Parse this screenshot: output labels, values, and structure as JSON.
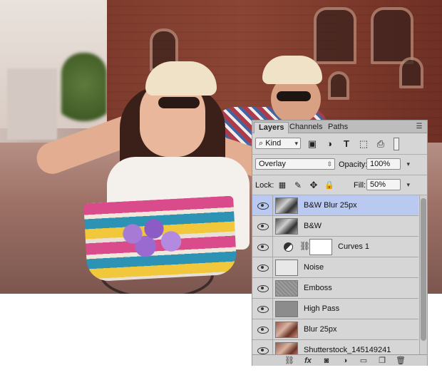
{
  "panel": {
    "tabs": [
      {
        "label": "Layers",
        "active": true
      },
      {
        "label": "Channels",
        "active": false
      },
      {
        "label": "Paths",
        "active": false
      }
    ],
    "filter": {
      "kind_label": "Kind",
      "icons": [
        "search-icon",
        "image-filter-icon",
        "adjustment-filter-icon",
        "type-filter-icon",
        "shape-filter-icon",
        "smart-object-filter-icon",
        "filter-toggle-icon"
      ]
    },
    "blend": {
      "mode": "Overlay",
      "opacity_label": "Opacity:",
      "opacity_value": "100%"
    },
    "lock": {
      "label": "Lock:",
      "icons": [
        "lock-transparent-icon",
        "lock-image-icon",
        "lock-position-icon",
        "lock-all-icon"
      ],
      "fill_label": "Fill:",
      "fill_value": "50%"
    },
    "layers": [
      {
        "name": "B&W Blur 25px",
        "thumb": "bw",
        "selected": true,
        "visible": true
      },
      {
        "name": "B&W",
        "thumb": "bw",
        "selected": false,
        "visible": true
      },
      {
        "name": "Curves 1",
        "thumb": "white",
        "adjustment": true,
        "selected": false,
        "visible": true
      },
      {
        "name": "Noise",
        "thumb": "noise",
        "selected": false,
        "visible": true
      },
      {
        "name": "Emboss",
        "thumb": "emboss",
        "selected": false,
        "visible": true
      },
      {
        "name": "High Pass",
        "thumb": "highpass",
        "selected": false,
        "visible": true
      },
      {
        "name": "Blur 25px",
        "thumb": "photo",
        "selected": false,
        "visible": true
      },
      {
        "name": "Shutterstock_145149241",
        "thumb": "photo",
        "selected": false,
        "visible": true
      }
    ],
    "footer_icons": [
      "link-layers-icon",
      "fx-icon",
      "add-mask-icon",
      "new-adjustment-icon",
      "new-group-icon",
      "new-layer-icon",
      "delete-layer-icon"
    ],
    "footer_fx_label": "fx"
  },
  "colors": {
    "panel_bg": "#d6d6d6",
    "selected_row": "#b9c9f0",
    "tab_bar": "#bdbdbd"
  }
}
